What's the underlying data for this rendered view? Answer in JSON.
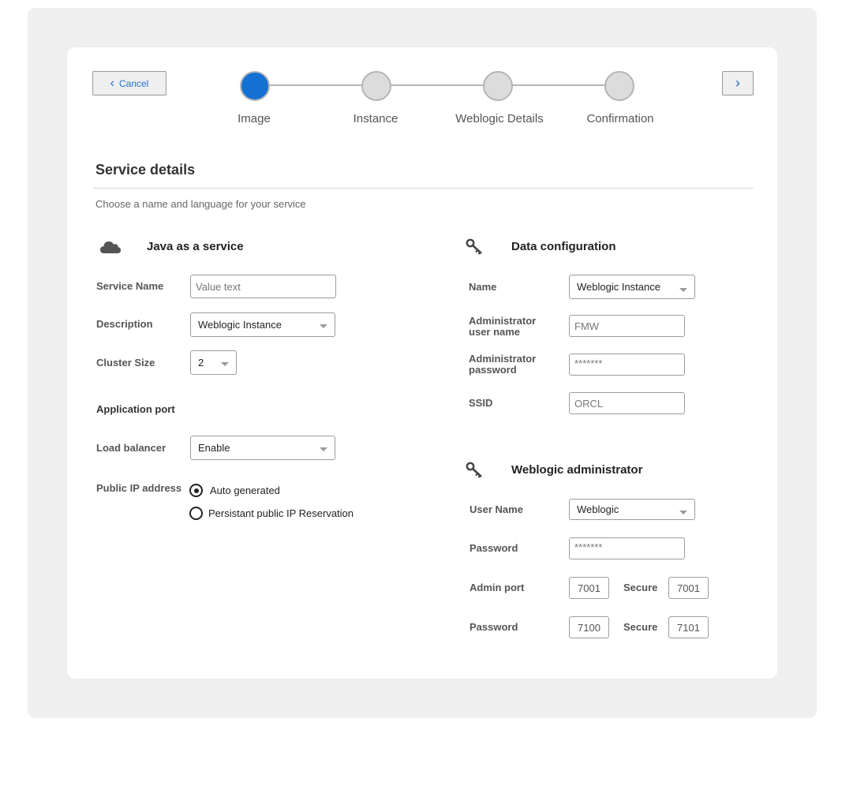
{
  "nav": {
    "cancel_label": "Cancel",
    "cancel_icon": "chevron-left-icon",
    "next_icon": "chevron-right-icon"
  },
  "steps": [
    {
      "label": "Image",
      "active": true
    },
    {
      "label": "Instance",
      "active": false
    },
    {
      "label": "Weblogic Details",
      "active": false
    },
    {
      "label": "Confirmation",
      "active": false
    }
  ],
  "colors": {
    "accent": "#1470d3",
    "panel_bg": "#efefef",
    "card_bg": "#ffffff"
  },
  "section": {
    "title": "Service details",
    "subtitle": "Choose a name and language for your service"
  },
  "java_service": {
    "title": "Java as a service",
    "icon": "cloud-icon",
    "service_name": {
      "label": "Service Name",
      "value": "Value text"
    },
    "description": {
      "label": "Description",
      "value": "Weblogic Instance"
    },
    "cluster_size": {
      "label": "Cluster Size",
      "value": "2"
    },
    "application_port_heading": "Application port",
    "load_balancer": {
      "label": "Load balancer",
      "value": "Enable"
    },
    "public_ip": {
      "label": "Public IP address",
      "options": [
        "Auto generated",
        "Persistant public IP Reservation"
      ],
      "selected": "Auto generated"
    }
  },
  "data_config": {
    "title": "Data configuration",
    "icon": "key-icon",
    "name": {
      "label": "Name",
      "value": "Weblogic Instance"
    },
    "admin_user": {
      "label": "Administrator user name",
      "value": "FMW"
    },
    "admin_password": {
      "label": "Administrator password",
      "value": "*******"
    },
    "ssid": {
      "label": "SSID",
      "value": "ORCL"
    }
  },
  "weblogic_admin": {
    "title": "Weblogic administrator",
    "icon": "key-icon",
    "user_name": {
      "label": "User Name",
      "value": "Weblogic"
    },
    "password": {
      "label": "Password",
      "value": "*******"
    },
    "admin_port": {
      "label": "Admin port",
      "value": "7001",
      "secure_label": "Secure",
      "secure_value": "7001"
    },
    "password_port": {
      "label": "Password",
      "value": "7100",
      "secure_label": "Secure",
      "secure_value": "7101"
    }
  }
}
